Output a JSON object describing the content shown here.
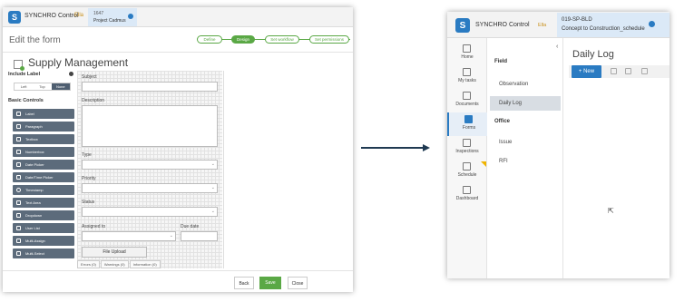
{
  "left_window": {
    "app_name": "SYNCHRO Control",
    "user_menu": "Ella",
    "project": {
      "code": "1647",
      "name": "Project Cadmus"
    },
    "edit_title": "Edit the form",
    "steps": [
      "Define",
      "Design",
      "Set workflow",
      "Set permissions"
    ],
    "form_title": "Supply Management",
    "include_label": {
      "title": "Include Label",
      "options": [
        "Left",
        "Top",
        "None"
      ],
      "selected": "None"
    },
    "basic_controls": {
      "title": "Basic Controls",
      "items": [
        {
          "label": "Label",
          "icon": "tag-icon"
        },
        {
          "label": "Paragraph",
          "icon": "paragraph-icon"
        },
        {
          "label": "Textbox",
          "icon": "textbox-icon"
        },
        {
          "label": "Numberbox",
          "icon": "numberbox-icon"
        },
        {
          "label": "Date Picker",
          "icon": "calendar-icon"
        },
        {
          "label": "Date/Time Picker",
          "icon": "calendar-clock-icon"
        },
        {
          "label": "Timestamp",
          "icon": "clock-icon"
        },
        {
          "label": "Text Area",
          "icon": "text-area-icon"
        },
        {
          "label": "Dropdown",
          "icon": "dropdown-icon"
        },
        {
          "label": "User List",
          "icon": "user-list-icon"
        },
        {
          "label": "Multi-Assign",
          "icon": "multi-assign-icon"
        },
        {
          "label": "Multi-Select",
          "icon": "multi-select-icon"
        }
      ]
    },
    "fields": {
      "subject": "Subject",
      "description": "Description",
      "type": "Type",
      "priority": "Priority",
      "status": "Status",
      "assigned_to": "Assigned to",
      "due_date": "Due date",
      "file_upload": "File Upload"
    },
    "tabs": [
      "Errors (0)",
      "Warnings (0)",
      "Information (0)"
    ],
    "footer": {
      "back": "Back",
      "save": "Save",
      "close": "Close"
    }
  },
  "right_window": {
    "app_name": "SYNCHRO Control",
    "user_menu": "Ella",
    "project": {
      "code": "019-SP-BLD",
      "name": "Concept to Construction_schedule"
    },
    "nav": [
      {
        "label": "Home",
        "icon": "home-icon"
      },
      {
        "label": "My tasks",
        "icon": "inbox-icon"
      },
      {
        "label": "Documents",
        "icon": "documents-icon"
      },
      {
        "label": "Forms",
        "icon": "forms-icon",
        "active": true
      },
      {
        "label": "Inspections",
        "icon": "inspections-icon"
      },
      {
        "label": "Schedule",
        "icon": "schedule-icon"
      },
      {
        "label": "Dashboard",
        "icon": "dashboard-icon"
      }
    ],
    "list": {
      "sections": [
        {
          "title": "Field",
          "items": [
            "Observation",
            "Daily Log"
          ]
        },
        {
          "title": "Office",
          "items": [
            "Issue",
            "RFI"
          ]
        }
      ],
      "selected": "Daily Log"
    },
    "main": {
      "title": "Daily Log",
      "new_button": "+ New",
      "toolbar_icons": [
        "filter-icon",
        "search-icon",
        "sort-icon"
      ]
    }
  },
  "colors": {
    "accent_blue": "#2a7bc2",
    "accent_green": "#5aa845",
    "sidebar_control": "#5c6b7b",
    "arrow": "#1f3a52"
  }
}
